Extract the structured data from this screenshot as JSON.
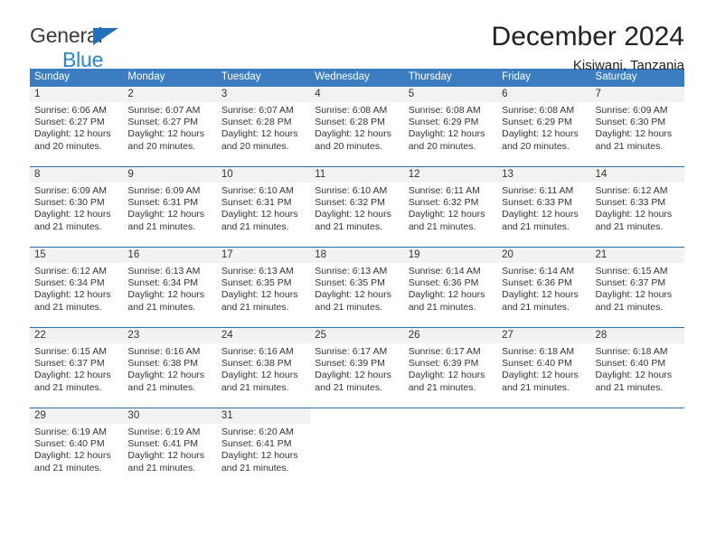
{
  "brand": {
    "name_top": "General",
    "name_bottom": "Blue",
    "triangle_color": "#1f72bb",
    "blue_color": "#2786d6"
  },
  "header": {
    "title": "December 2024",
    "subtitle": "Kisiwani, Tanzania"
  },
  "theme": {
    "header_bar": "#3b7dc0",
    "week_rule": "#2f6ca8",
    "day_number_bg": "#f2f2f2",
    "text": "#333333"
  },
  "weekdays": [
    "Sunday",
    "Monday",
    "Tuesday",
    "Wednesday",
    "Thursday",
    "Friday",
    "Saturday"
  ],
  "weeks": [
    [
      {
        "day": "1",
        "sunrise": "Sunrise: 6:06 AM",
        "sunset": "Sunset: 6:27 PM",
        "daylight_1": "Daylight: 12 hours",
        "daylight_2": "and 20 minutes."
      },
      {
        "day": "2",
        "sunrise": "Sunrise: 6:07 AM",
        "sunset": "Sunset: 6:27 PM",
        "daylight_1": "Daylight: 12 hours",
        "daylight_2": "and 20 minutes."
      },
      {
        "day": "3",
        "sunrise": "Sunrise: 6:07 AM",
        "sunset": "Sunset: 6:28 PM",
        "daylight_1": "Daylight: 12 hours",
        "daylight_2": "and 20 minutes."
      },
      {
        "day": "4",
        "sunrise": "Sunrise: 6:08 AM",
        "sunset": "Sunset: 6:28 PM",
        "daylight_1": "Daylight: 12 hours",
        "daylight_2": "and 20 minutes."
      },
      {
        "day": "5",
        "sunrise": "Sunrise: 6:08 AM",
        "sunset": "Sunset: 6:29 PM",
        "daylight_1": "Daylight: 12 hours",
        "daylight_2": "and 20 minutes."
      },
      {
        "day": "6",
        "sunrise": "Sunrise: 6:08 AM",
        "sunset": "Sunset: 6:29 PM",
        "daylight_1": "Daylight: 12 hours",
        "daylight_2": "and 20 minutes."
      },
      {
        "day": "7",
        "sunrise": "Sunrise: 6:09 AM",
        "sunset": "Sunset: 6:30 PM",
        "daylight_1": "Daylight: 12 hours",
        "daylight_2": "and 21 minutes."
      }
    ],
    [
      {
        "day": "8",
        "sunrise": "Sunrise: 6:09 AM",
        "sunset": "Sunset: 6:30 PM",
        "daylight_1": "Daylight: 12 hours",
        "daylight_2": "and 21 minutes."
      },
      {
        "day": "9",
        "sunrise": "Sunrise: 6:09 AM",
        "sunset": "Sunset: 6:31 PM",
        "daylight_1": "Daylight: 12 hours",
        "daylight_2": "and 21 minutes."
      },
      {
        "day": "10",
        "sunrise": "Sunrise: 6:10 AM",
        "sunset": "Sunset: 6:31 PM",
        "daylight_1": "Daylight: 12 hours",
        "daylight_2": "and 21 minutes."
      },
      {
        "day": "11",
        "sunrise": "Sunrise: 6:10 AM",
        "sunset": "Sunset: 6:32 PM",
        "daylight_1": "Daylight: 12 hours",
        "daylight_2": "and 21 minutes."
      },
      {
        "day": "12",
        "sunrise": "Sunrise: 6:11 AM",
        "sunset": "Sunset: 6:32 PM",
        "daylight_1": "Daylight: 12 hours",
        "daylight_2": "and 21 minutes."
      },
      {
        "day": "13",
        "sunrise": "Sunrise: 6:11 AM",
        "sunset": "Sunset: 6:33 PM",
        "daylight_1": "Daylight: 12 hours",
        "daylight_2": "and 21 minutes."
      },
      {
        "day": "14",
        "sunrise": "Sunrise: 6:12 AM",
        "sunset": "Sunset: 6:33 PM",
        "daylight_1": "Daylight: 12 hours",
        "daylight_2": "and 21 minutes."
      }
    ],
    [
      {
        "day": "15",
        "sunrise": "Sunrise: 6:12 AM",
        "sunset": "Sunset: 6:34 PM",
        "daylight_1": "Daylight: 12 hours",
        "daylight_2": "and 21 minutes."
      },
      {
        "day": "16",
        "sunrise": "Sunrise: 6:13 AM",
        "sunset": "Sunset: 6:34 PM",
        "daylight_1": "Daylight: 12 hours",
        "daylight_2": "and 21 minutes."
      },
      {
        "day": "17",
        "sunrise": "Sunrise: 6:13 AM",
        "sunset": "Sunset: 6:35 PM",
        "daylight_1": "Daylight: 12 hours",
        "daylight_2": "and 21 minutes."
      },
      {
        "day": "18",
        "sunrise": "Sunrise: 6:13 AM",
        "sunset": "Sunset: 6:35 PM",
        "daylight_1": "Daylight: 12 hours",
        "daylight_2": "and 21 minutes."
      },
      {
        "day": "19",
        "sunrise": "Sunrise: 6:14 AM",
        "sunset": "Sunset: 6:36 PM",
        "daylight_1": "Daylight: 12 hours",
        "daylight_2": "and 21 minutes."
      },
      {
        "day": "20",
        "sunrise": "Sunrise: 6:14 AM",
        "sunset": "Sunset: 6:36 PM",
        "daylight_1": "Daylight: 12 hours",
        "daylight_2": "and 21 minutes."
      },
      {
        "day": "21",
        "sunrise": "Sunrise: 6:15 AM",
        "sunset": "Sunset: 6:37 PM",
        "daylight_1": "Daylight: 12 hours",
        "daylight_2": "and 21 minutes."
      }
    ],
    [
      {
        "day": "22",
        "sunrise": "Sunrise: 6:15 AM",
        "sunset": "Sunset: 6:37 PM",
        "daylight_1": "Daylight: 12 hours",
        "daylight_2": "and 21 minutes."
      },
      {
        "day": "23",
        "sunrise": "Sunrise: 6:16 AM",
        "sunset": "Sunset: 6:38 PM",
        "daylight_1": "Daylight: 12 hours",
        "daylight_2": "and 21 minutes."
      },
      {
        "day": "24",
        "sunrise": "Sunrise: 6:16 AM",
        "sunset": "Sunset: 6:38 PM",
        "daylight_1": "Daylight: 12 hours",
        "daylight_2": "and 21 minutes."
      },
      {
        "day": "25",
        "sunrise": "Sunrise: 6:17 AM",
        "sunset": "Sunset: 6:39 PM",
        "daylight_1": "Daylight: 12 hours",
        "daylight_2": "and 21 minutes."
      },
      {
        "day": "26",
        "sunrise": "Sunrise: 6:17 AM",
        "sunset": "Sunset: 6:39 PM",
        "daylight_1": "Daylight: 12 hours",
        "daylight_2": "and 21 minutes."
      },
      {
        "day": "27",
        "sunrise": "Sunrise: 6:18 AM",
        "sunset": "Sunset: 6:40 PM",
        "daylight_1": "Daylight: 12 hours",
        "daylight_2": "and 21 minutes."
      },
      {
        "day": "28",
        "sunrise": "Sunrise: 6:18 AM",
        "sunset": "Sunset: 6:40 PM",
        "daylight_1": "Daylight: 12 hours",
        "daylight_2": "and 21 minutes."
      }
    ],
    [
      {
        "day": "29",
        "sunrise": "Sunrise: 6:19 AM",
        "sunset": "Sunset: 6:40 PM",
        "daylight_1": "Daylight: 12 hours",
        "daylight_2": "and 21 minutes."
      },
      {
        "day": "30",
        "sunrise": "Sunrise: 6:19 AM",
        "sunset": "Sunset: 6:41 PM",
        "daylight_1": "Daylight: 12 hours",
        "daylight_2": "and 21 minutes."
      },
      {
        "day": "31",
        "sunrise": "Sunrise: 6:20 AM",
        "sunset": "Sunset: 6:41 PM",
        "daylight_1": "Daylight: 12 hours",
        "daylight_2": "and 21 minutes."
      },
      {
        "day": "",
        "sunrise": "",
        "sunset": "",
        "daylight_1": "",
        "daylight_2": ""
      },
      {
        "day": "",
        "sunrise": "",
        "sunset": "",
        "daylight_1": "",
        "daylight_2": ""
      },
      {
        "day": "",
        "sunrise": "",
        "sunset": "",
        "daylight_1": "",
        "daylight_2": ""
      },
      {
        "day": "",
        "sunrise": "",
        "sunset": "",
        "daylight_1": "",
        "daylight_2": ""
      }
    ]
  ]
}
